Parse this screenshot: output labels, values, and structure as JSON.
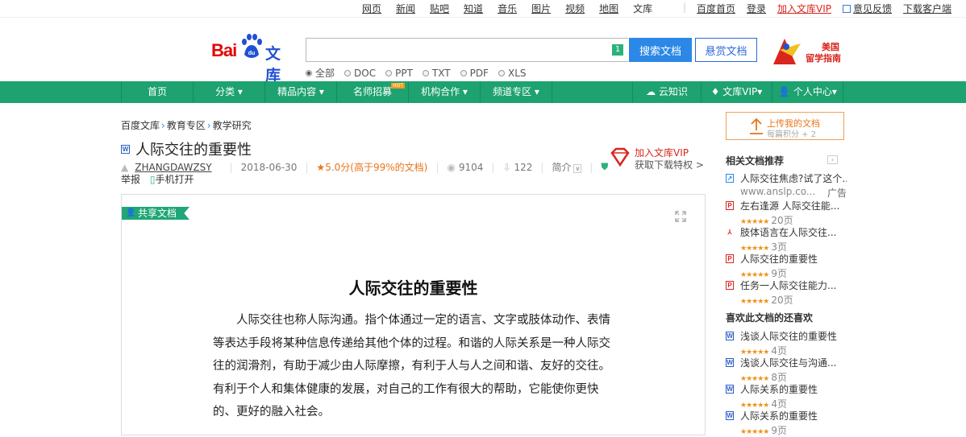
{
  "topnav": {
    "links": [
      "网页",
      "新闻",
      "贴吧",
      "知道",
      "音乐",
      "图片",
      "视频",
      "地图"
    ],
    "current": "文库",
    "right": [
      "百度首页",
      "登录"
    ],
    "vip": "加入文库VIP",
    "feedback": "意见反馈",
    "download": "下载客户端"
  },
  "logo": {
    "bai": "Bai",
    "du": "du",
    "wenku": "文库"
  },
  "search": {
    "keyboard_badge": "1",
    "search_label": "搜索文档",
    "reward_label": "悬赏文档",
    "types": [
      "全部",
      "DOC",
      "PPT",
      "TXT",
      "PDF",
      "XLS"
    ],
    "selected_type": "全部"
  },
  "ad": {
    "line1": "美国",
    "line2": "留学指南"
  },
  "nav": {
    "items": [
      {
        "label": "首页"
      },
      {
        "label": "分类 ▾"
      },
      {
        "label": "精品内容 ▾"
      },
      {
        "label": "名师招募",
        "badge": "HOT"
      },
      {
        "label": "机构合作 ▾"
      },
      {
        "label": "频道专区 ▾"
      }
    ],
    "right": [
      "云知识",
      "文库VIP▾",
      "个人中心▾"
    ]
  },
  "breadcrumb": [
    "百度文库",
    "教育专区",
    "教学研究"
  ],
  "doc": {
    "title": "人际交往的重要性",
    "author": "ZHANGDAWZSY",
    "date": "2018-06-30",
    "rating": "5.0分(高于99%的文档)",
    "views": "9104",
    "downloads": "122",
    "intro": "简介",
    "report": "举报",
    "mobile": "手机打开",
    "share_tag": "共享文档"
  },
  "vip_promo": {
    "line1": "加入文库VIP",
    "line2": "获取下载特权 >"
  },
  "paper": {
    "title": "人际交往的重要性",
    "body": "人际交往也称人际沟通。指个体通过一定的语言、文字或肢体动作、表情等表达手段将某种信息传递给其他个体的过程。和谐的人际关系是一种人际交往的润滑剂，有助于减少由人际摩擦，有利于人与人之间和谐、友好的交往。有利于个人和集体健康的发展，对自己的工作有很大的帮助，它能使你更快的、更好的融入社会。"
  },
  "sidebar": {
    "upload": {
      "line1": "上传我的文档",
      "line2": "每篇积分 + 2"
    },
    "related_title": "相关文档推荐",
    "related": [
      {
        "icon": "lnk",
        "title": "人际交往焦虑?试了这个...",
        "sub": "www.anslp.co...",
        "ad": "广告"
      },
      {
        "icon": "p",
        "title": "左右逢源 人际交往能...",
        "stars": "★★★★★",
        "pages": "20页"
      },
      {
        "icon": "pdf",
        "title": "肢体语言在人际交往...",
        "stars": "★★★★★",
        "pages": "3页"
      },
      {
        "icon": "p",
        "title": "人际交往的重要性",
        "stars": "★★★★★",
        "pages": "9页"
      },
      {
        "icon": "p",
        "title": "任务一人际交往能力...",
        "stars": "★★★★★",
        "pages": "20页"
      }
    ],
    "also_title": "喜欢此文档的还喜欢",
    "also": [
      {
        "icon": "w",
        "title": "浅谈人际交往的重要性",
        "stars": "★★★★★",
        "pages": "4页"
      },
      {
        "icon": "w",
        "title": "浅谈人际交往与沟通...",
        "stars": "★★★★★",
        "pages": "8页"
      },
      {
        "icon": "w",
        "title": "人际关系的重要性",
        "stars": "★★★★★",
        "pages": "4页"
      },
      {
        "icon": "w",
        "title": "人际关系的重要性",
        "stars": "★★★★★",
        "pages": "9页"
      }
    ]
  }
}
